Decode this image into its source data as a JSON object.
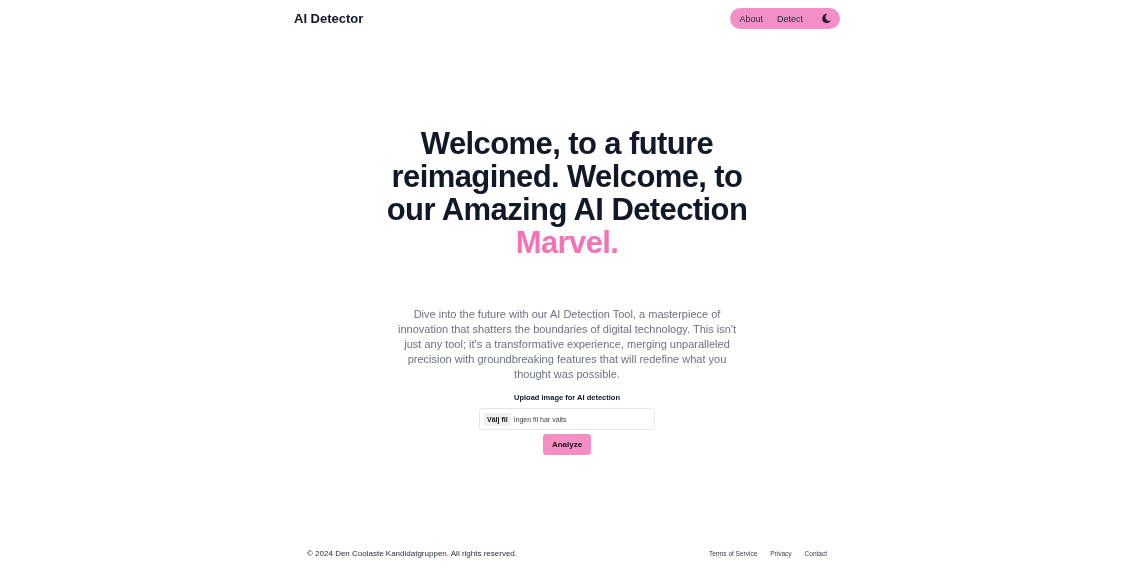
{
  "header": {
    "brand": "AI Detector",
    "nav": [
      {
        "label": "About"
      },
      {
        "label": "Detect"
      }
    ]
  },
  "hero": {
    "heading": "Welcome, to a future reimagined. Welcome, to our Amazing AI Detection",
    "highlight": "Marvel.",
    "description": "Dive into the future with our AI Detection Tool, a masterpiece of innovation that shatters the boundaries of digital technology. This isn't just any tool; it's a transformative experience, merging unparalleled precision with groundbreaking features that will redefine what you thought was possible."
  },
  "upload": {
    "label": "Upload image for AI detection",
    "choose_button": "Välj fil",
    "file_status": "Ingen fil har valts",
    "submit": "Analyze"
  },
  "footer": {
    "copyright": "© 2024 Den Coolaste Kandidatgruppen. All rights reserved.",
    "links": [
      {
        "label": "Terms of Service"
      },
      {
        "label": "Privacy"
      },
      {
        "label": "Contact"
      }
    ]
  }
}
